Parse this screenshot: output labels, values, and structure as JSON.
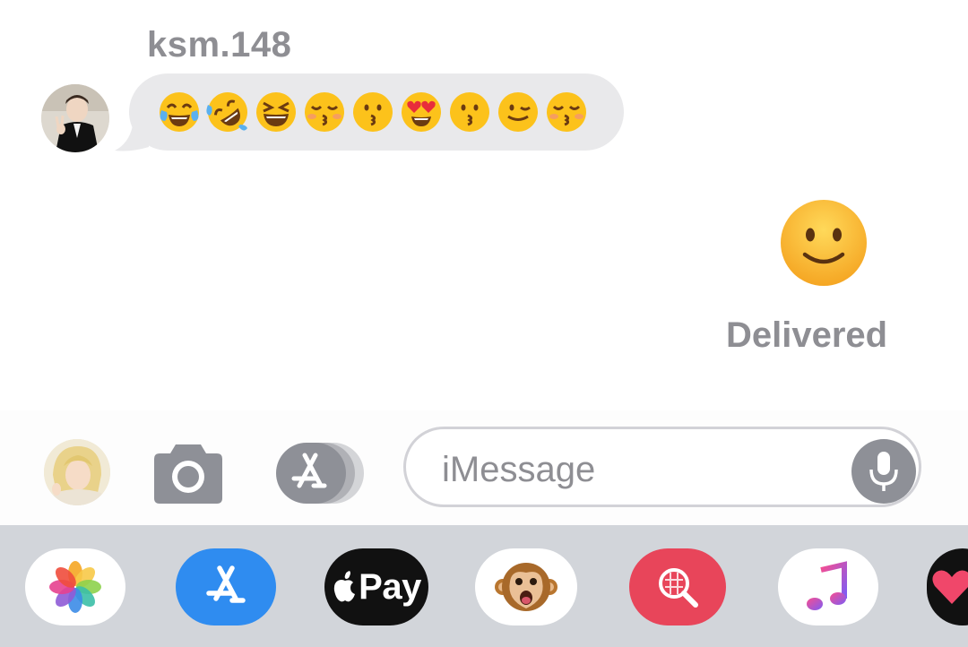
{
  "conversation": {
    "sender_name": "ksm.148",
    "incoming_emojis": [
      "😂",
      "🤣",
      "😆",
      "😚",
      "😗",
      "😍",
      "😗",
      "😉",
      "😚"
    ],
    "outgoing_emoji": "🙂",
    "delivery_status": "Delivered"
  },
  "composer": {
    "placeholder": "iMessage",
    "icons": [
      "avatar",
      "camera-icon",
      "app-store-icon",
      "microphone-icon"
    ]
  },
  "app_drawer": {
    "apps": [
      {
        "name": "Photos",
        "icon": "photos-icon"
      },
      {
        "name": "App Store",
        "icon": "app-store-icon"
      },
      {
        "name": "Apple Pay",
        "icon": "apple-pay-icon",
        "label": "Pay"
      },
      {
        "name": "Animoji",
        "icon": "monkey-animoji-icon"
      },
      {
        "name": "Images",
        "icon": "image-search-icon"
      },
      {
        "name": "Music",
        "icon": "music-note-icon"
      },
      {
        "name": "Digital Touch",
        "icon": "heart-icon"
      }
    ]
  },
  "colors": {
    "bubble_gray": "#e9e9eb",
    "label_gray": "#8e8e93",
    "drawer_gray": "#d2d5da",
    "apple_pay_black": "#111111",
    "appstore_blue": "#2f8cf0",
    "images_red": "#e8455a"
  }
}
